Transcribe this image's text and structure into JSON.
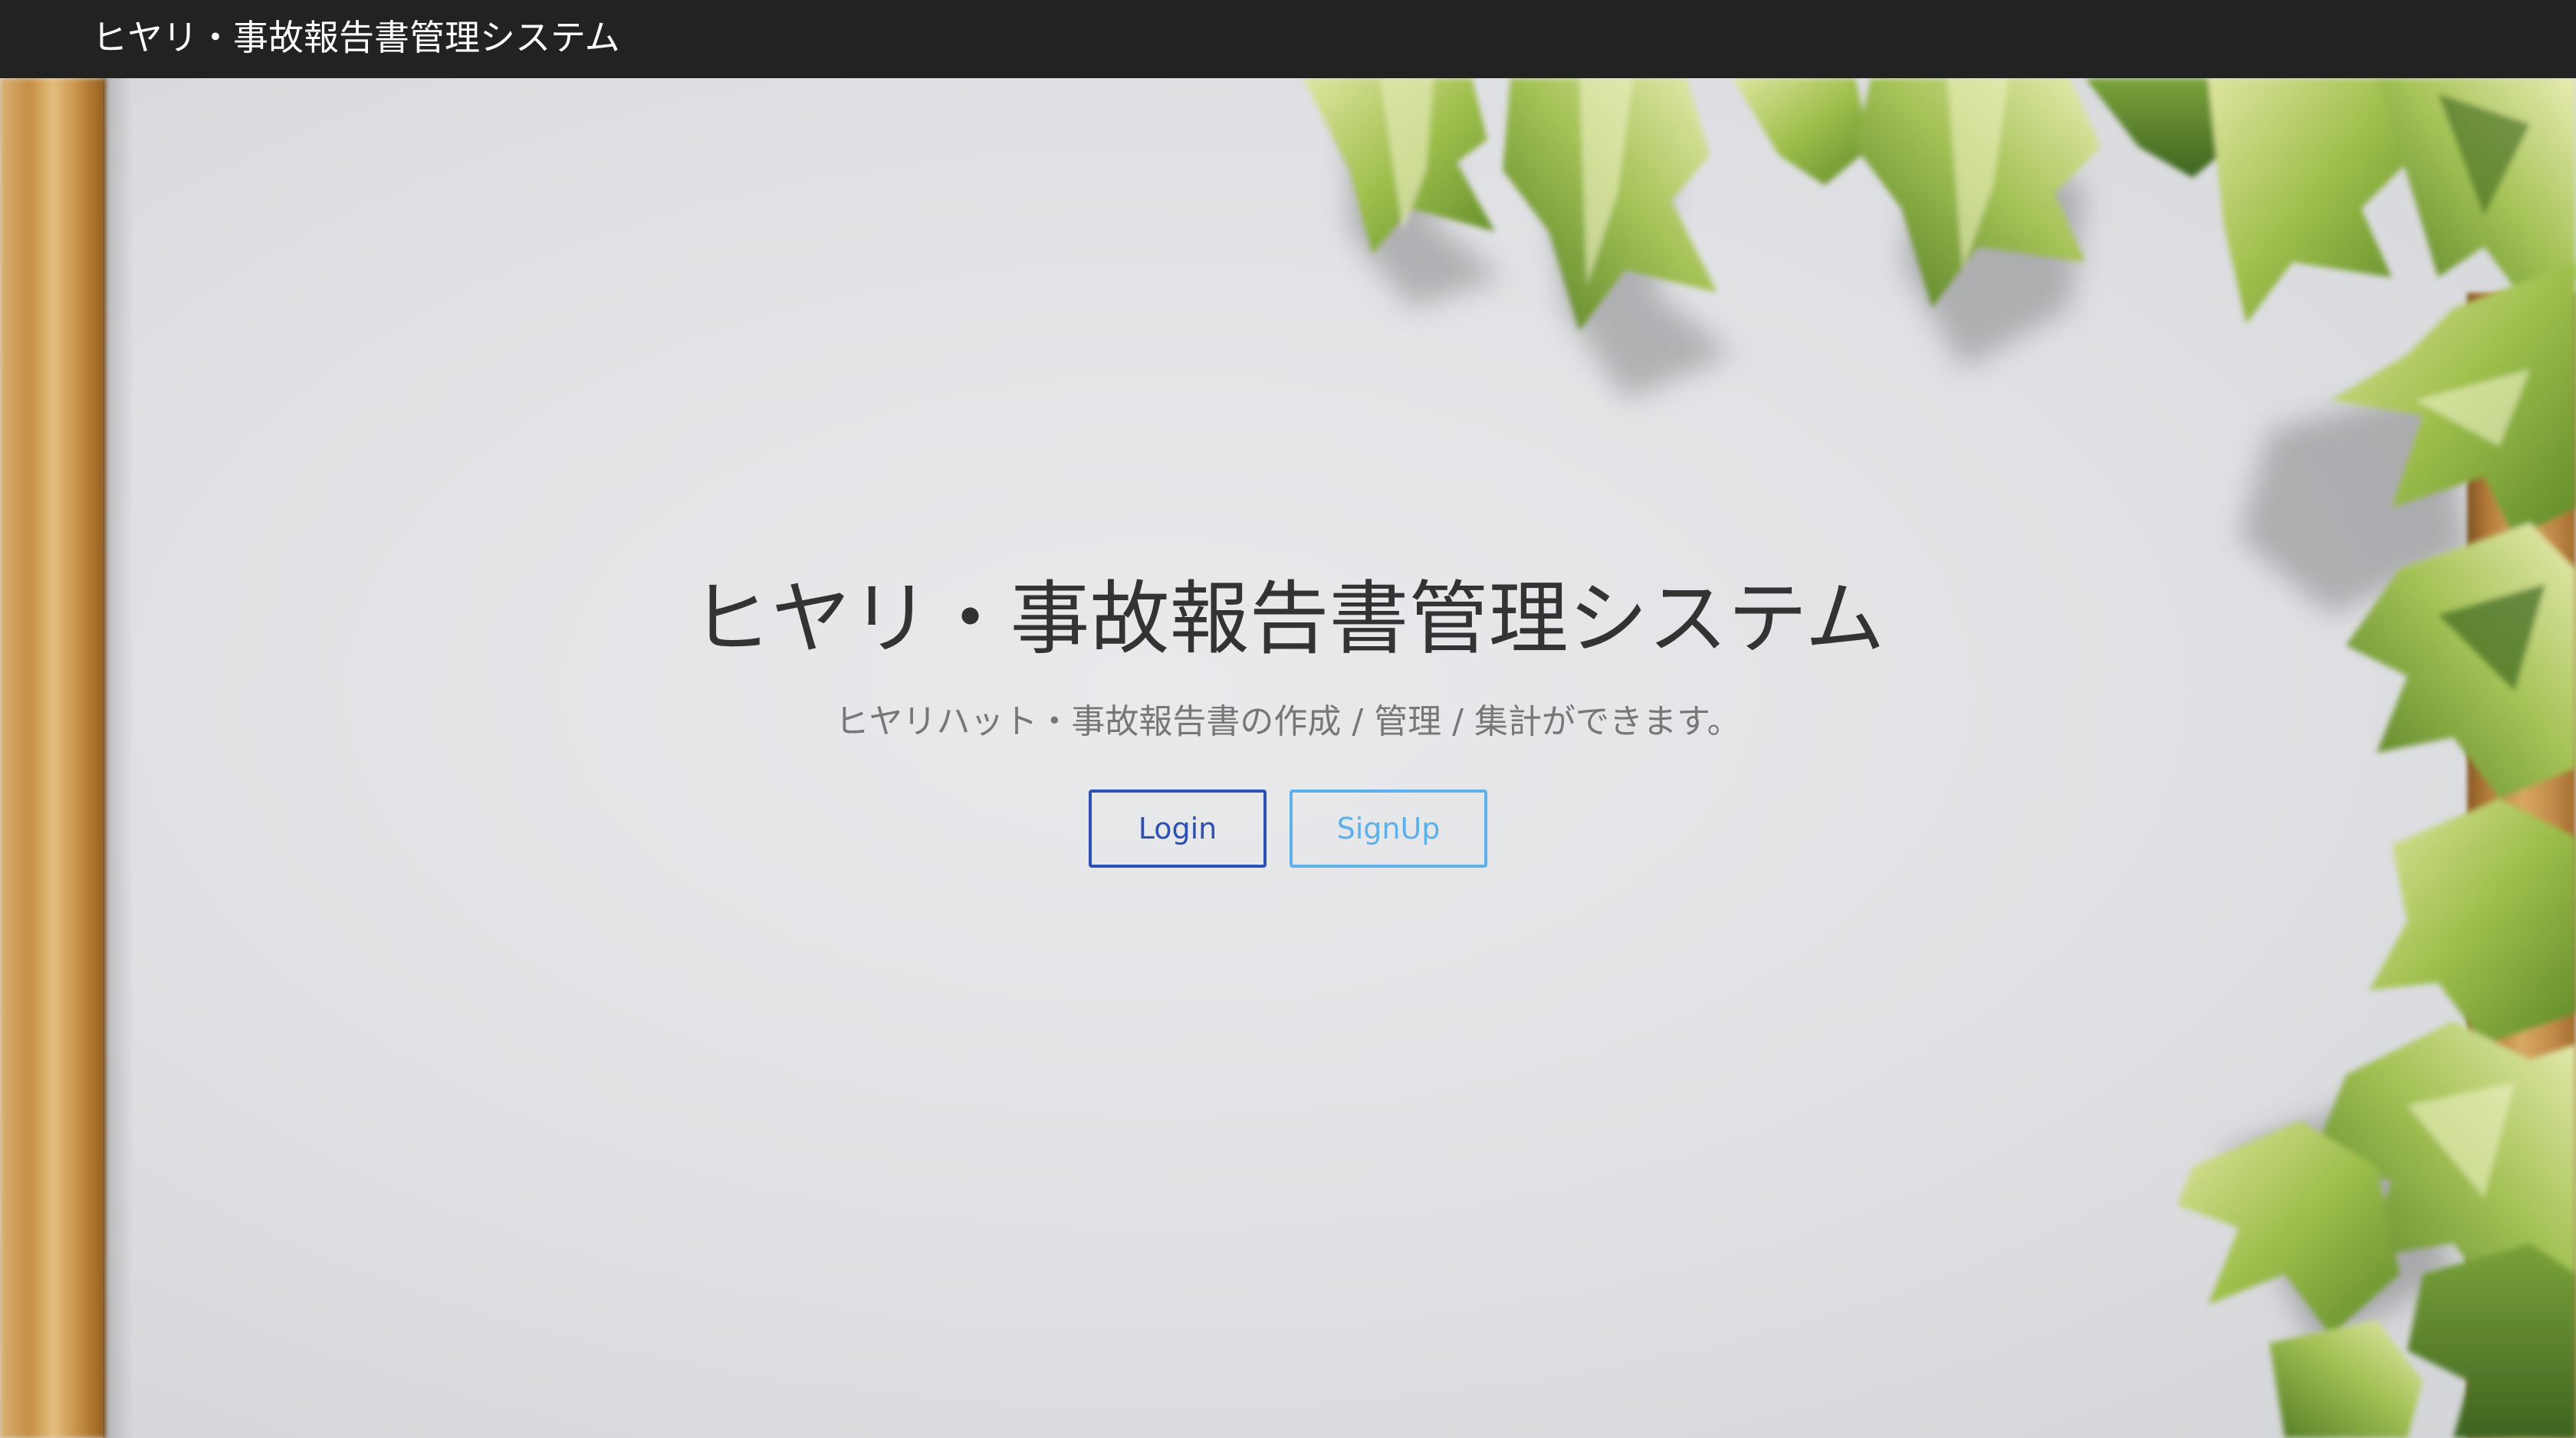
{
  "navbar": {
    "brand": "ヒヤリ・事故報告書管理システム"
  },
  "hero": {
    "title": "ヒヤリ・事故報告書管理システム",
    "subtitle": "ヒヤリハット・事故報告書の作成 / 管理 / 集計ができます。",
    "buttons": {
      "login_label": "Login",
      "signup_label": "SignUp"
    }
  },
  "colors": {
    "navbar_bg": "#222222",
    "login": "#2c50b3",
    "signup": "#5db0ea"
  },
  "background_image": "ivy-leaves-wooden-frame"
}
